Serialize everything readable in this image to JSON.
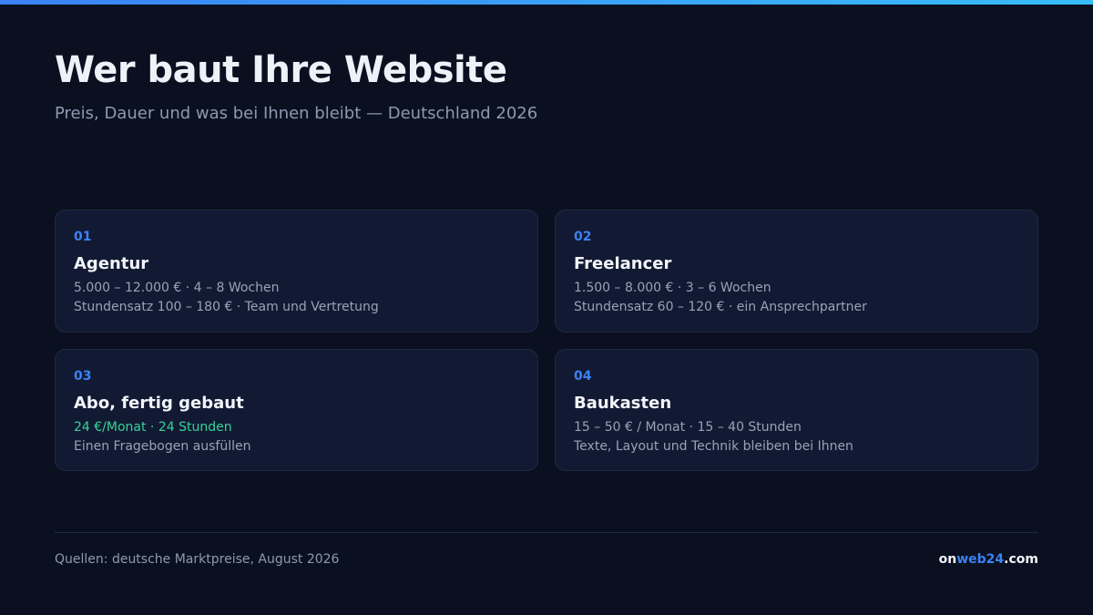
{
  "colors": {
    "background": "#0b1020",
    "accent": "#3b82f6",
    "highlight": "#34d399",
    "card": "#121a33"
  },
  "header": {
    "title": "Wer baut Ihre Website",
    "subtitle": "Preis, Dauer und was bei Ihnen bleibt — Deutschland 2026"
  },
  "cards": [
    {
      "number": "01",
      "title": "Agentur",
      "line1": "5.000 – 12.000 € · 4 – 8 Wochen",
      "line2": "Stundensatz 100 – 180 € · Team und Vertretung"
    },
    {
      "number": "02",
      "title": "Freelancer",
      "line1": "1.500 – 8.000 € · 3 – 6 Wochen",
      "line2": "Stundensatz 60 – 120 € · ein Ansprechpartner"
    },
    {
      "number": "03",
      "title": "Abo, fertig gebaut",
      "line1": "24 €/Monat · 24 Stunden",
      "line2": "Einen Fragebogen ausfüllen"
    },
    {
      "number": "04",
      "title": "Baukasten",
      "line1": "15 – 50 € / Monat · 15 – 40 Stunden",
      "line2": "Texte, Layout und Technik bleiben bei Ihnen"
    }
  ],
  "footer": {
    "source": "Quellen: deutsche Marktpreise, August 2026",
    "brand_prefix": "on",
    "brand_middle": "web24",
    "brand_suffix": ".com"
  }
}
